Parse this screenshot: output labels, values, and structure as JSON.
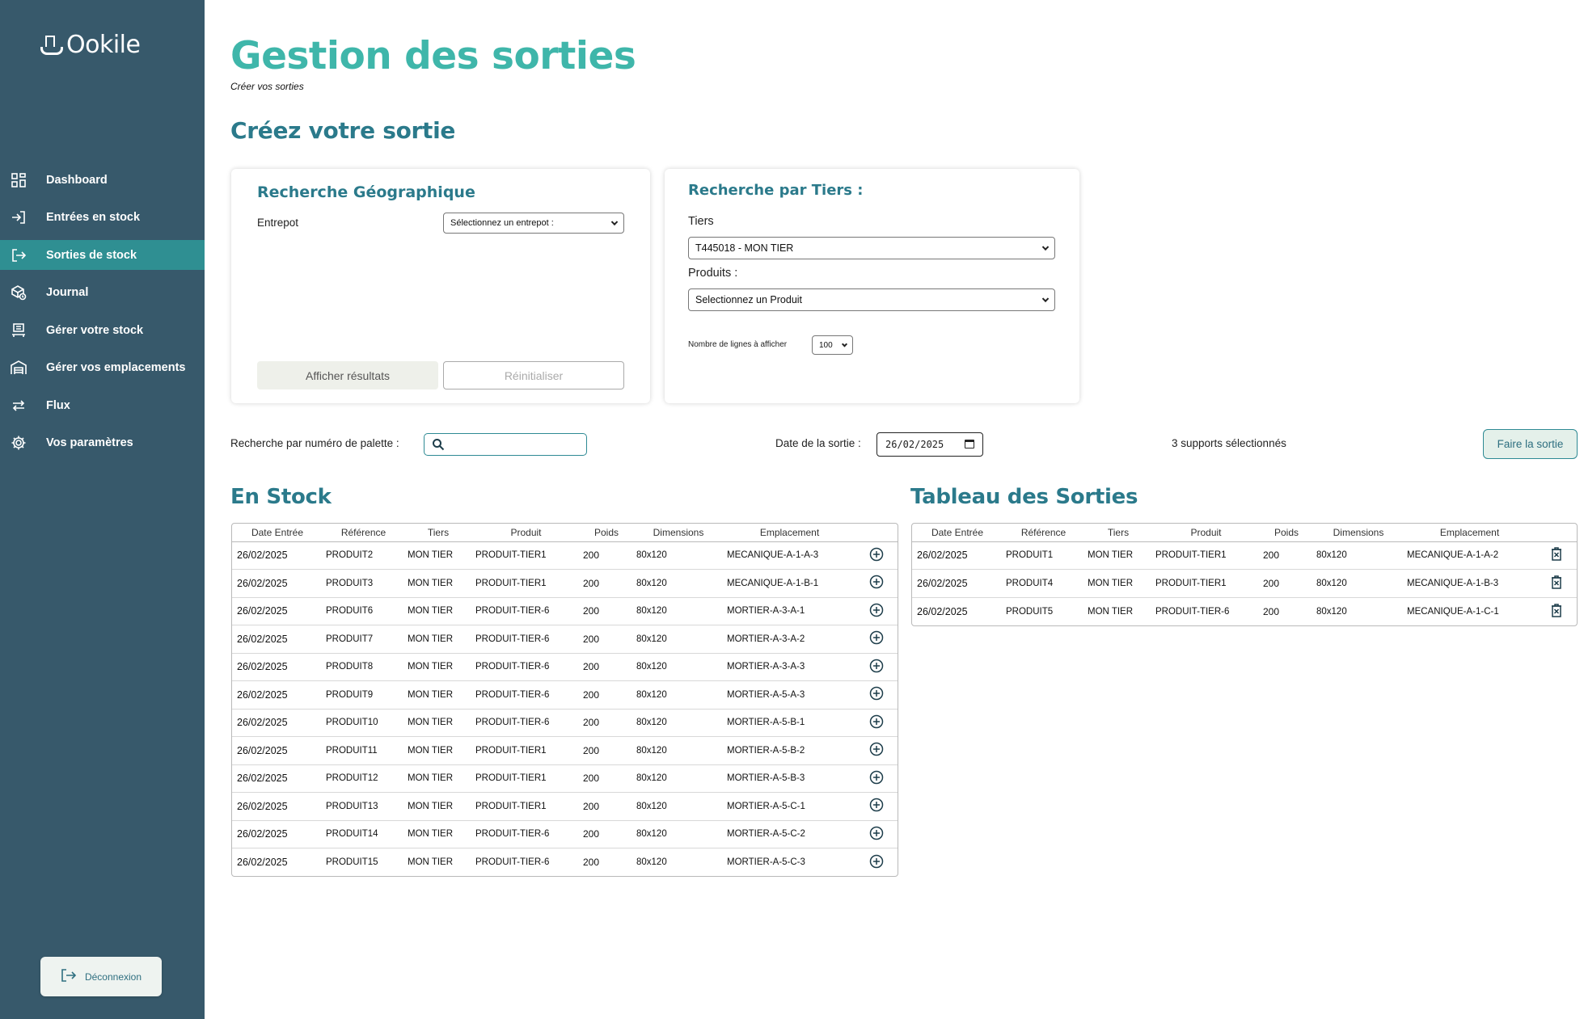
{
  "app": {
    "brand": "Ookile"
  },
  "sidebar": {
    "items": [
      {
        "label": "Dashboard",
        "icon": "dashboard-icon",
        "active": false
      },
      {
        "label": "Entrées en stock",
        "icon": "enter-icon",
        "active": false
      },
      {
        "label": "Sorties de stock",
        "icon": "exit-icon",
        "active": true
      },
      {
        "label": "Journal",
        "icon": "journal-icon",
        "active": false
      },
      {
        "label": "Gérer votre stock",
        "icon": "stock-icon",
        "active": false
      },
      {
        "label": "Gérer vos emplacements",
        "icon": "warehouse-icon",
        "active": false
      },
      {
        "label": "Flux",
        "icon": "flux-icon",
        "active": false
      },
      {
        "label": "Vos paramètres",
        "icon": "gear-icon",
        "active": false
      }
    ],
    "logout_label": "Déconnexion"
  },
  "header": {
    "title": "Gestion des sorties",
    "subtitle": "Créer vos sorties",
    "section_title": "Créez votre sortie"
  },
  "geo_search": {
    "title": "Recherche Géographique",
    "warehouse_label": "Entrepot",
    "warehouse_value": "Sélectionnez un entrepot :",
    "show_results_label": "Afficher résultats",
    "reset_label": "Réinitialiser"
  },
  "tier_search": {
    "title": "Recherche par Tiers :",
    "tier_label": "Tiers",
    "tier_value": "T445018 - MON TIER",
    "products_label": "Produits :",
    "products_value": "Selectionnez un Produit",
    "rows_label": "Nombre de lignes à afficher",
    "rows_value": "100"
  },
  "toolbar": {
    "palette_search_label": "Recherche par numéro de palette :",
    "palette_search_value": "",
    "exit_date_label": "Date de la sortie :",
    "exit_date_value": "26/02/2025",
    "selected_count": "3 supports sélectionnés",
    "submit_label": "Faire la sortie"
  },
  "columns": [
    "Date Entrée",
    "Référence",
    "Tiers",
    "Produit",
    "Poids",
    "Dimensions",
    "Emplacement"
  ],
  "stock_table": {
    "title": "En Stock",
    "rows": [
      [
        "26/02/2025",
        "PRODUIT2",
        "MON TIER",
        "PRODUIT-TIER1",
        "200",
        "80x120",
        "MECANIQUE-A-1-A-3"
      ],
      [
        "26/02/2025",
        "PRODUIT3",
        "MON TIER",
        "PRODUIT-TIER1",
        "200",
        "80x120",
        "MECANIQUE-A-1-B-1"
      ],
      [
        "26/02/2025",
        "PRODUIT6",
        "MON TIER",
        "PRODUIT-TIER-6",
        "200",
        "80x120",
        "MORTIER-A-3-A-1"
      ],
      [
        "26/02/2025",
        "PRODUIT7",
        "MON TIER",
        "PRODUIT-TIER-6",
        "200",
        "80x120",
        "MORTIER-A-3-A-2"
      ],
      [
        "26/02/2025",
        "PRODUIT8",
        "MON TIER",
        "PRODUIT-TIER-6",
        "200",
        "80x120",
        "MORTIER-A-3-A-3"
      ],
      [
        "26/02/2025",
        "PRODUIT9",
        "MON TIER",
        "PRODUIT-TIER-6",
        "200",
        "80x120",
        "MORTIER-A-5-A-3"
      ],
      [
        "26/02/2025",
        "PRODUIT10",
        "MON TIER",
        "PRODUIT-TIER-6",
        "200",
        "80x120",
        "MORTIER-A-5-B-1"
      ],
      [
        "26/02/2025",
        "PRODUIT11",
        "MON TIER",
        "PRODUIT-TIER1",
        "200",
        "80x120",
        "MORTIER-A-5-B-2"
      ],
      [
        "26/02/2025",
        "PRODUIT12",
        "MON TIER",
        "PRODUIT-TIER1",
        "200",
        "80x120",
        "MORTIER-A-5-B-3"
      ],
      [
        "26/02/2025",
        "PRODUIT13",
        "MON TIER",
        "PRODUIT-TIER1",
        "200",
        "80x120",
        "MORTIER-A-5-C-1"
      ],
      [
        "26/02/2025",
        "PRODUIT14",
        "MON TIER",
        "PRODUIT-TIER-6",
        "200",
        "80x120",
        "MORTIER-A-5-C-2"
      ],
      [
        "26/02/2025",
        "PRODUIT15",
        "MON TIER",
        "PRODUIT-TIER-6",
        "200",
        "80x120",
        "MORTIER-A-5-C-3"
      ]
    ],
    "row_action_icon": "plus-circle-icon"
  },
  "exit_table": {
    "title": "Tableau des Sorties",
    "rows": [
      [
        "26/02/2025",
        "PRODUIT1",
        "MON TIER",
        "PRODUIT-TIER1",
        "200",
        "80x120",
        "MECANIQUE-A-1-A-2"
      ],
      [
        "26/02/2025",
        "PRODUIT4",
        "MON TIER",
        "PRODUIT-TIER1",
        "200",
        "80x120",
        "MECANIQUE-A-1-B-3"
      ],
      [
        "26/02/2025",
        "PRODUIT5",
        "MON TIER",
        "PRODUIT-TIER-6",
        "200",
        "80x120",
        "MECANIQUE-A-1-C-1"
      ]
    ],
    "row_action_icon": "trash-icon"
  },
  "colors": {
    "sidebar_bg": "#37596b",
    "active_bg": "#2f8f92",
    "title": "#3fb6aa",
    "heading": "#2b7a8b"
  }
}
